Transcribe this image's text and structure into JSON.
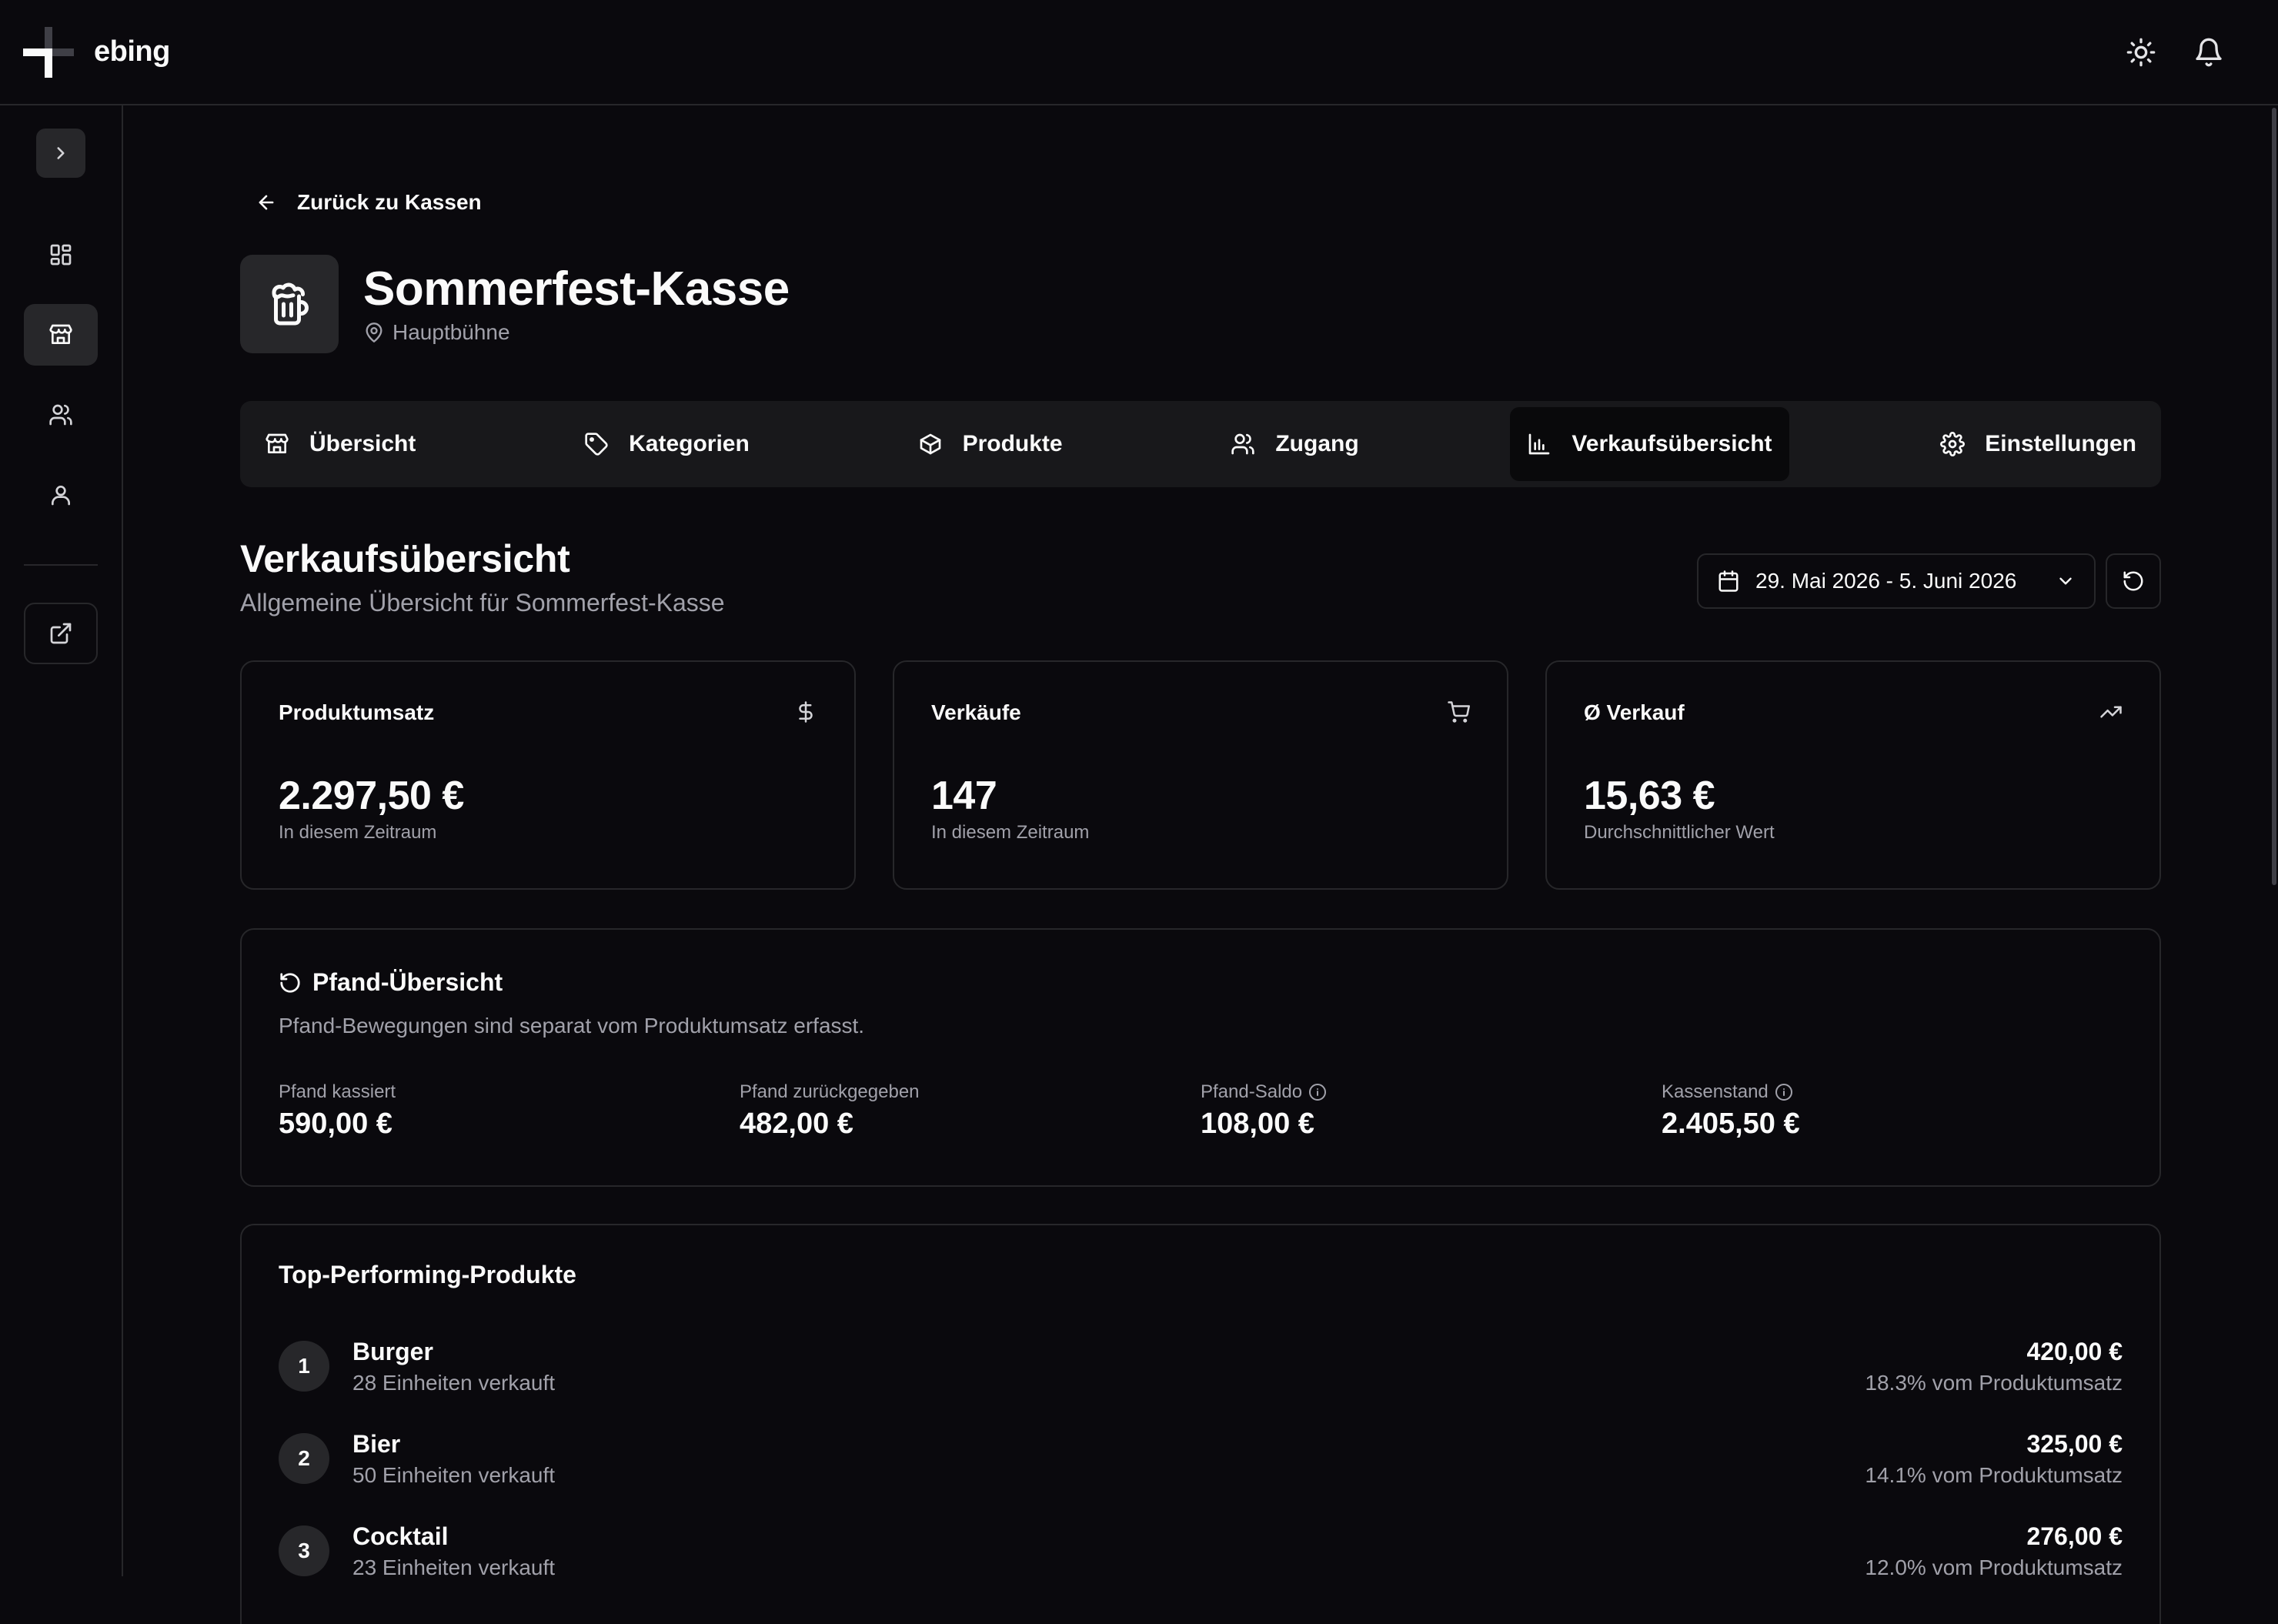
{
  "app": {
    "name": "ebing"
  },
  "nav": {
    "back_label": "Zurück zu Kassen"
  },
  "kasse": {
    "title": "Sommerfest-Kasse",
    "location": "Hauptbühne"
  },
  "tabs": [
    {
      "label": "Übersicht",
      "icon": "store-icon"
    },
    {
      "label": "Kategorien",
      "icon": "tag-icon"
    },
    {
      "label": "Produkte",
      "icon": "package-icon"
    },
    {
      "label": "Zugang",
      "icon": "users-icon"
    },
    {
      "label": "Verkaufsübersicht",
      "icon": "bar-chart-icon",
      "active": true
    },
    {
      "label": "Einstellungen",
      "icon": "gear-icon"
    }
  ],
  "section": {
    "title": "Verkaufsübersicht",
    "subtitle": "Allgemeine Übersicht für Sommerfest-Kasse",
    "date_range": "29. Mai 2026 - 5. Juni 2026"
  },
  "stats": [
    {
      "label": "Produktumsatz",
      "value": "2.297,50 €",
      "note": "In diesem Zeitraum",
      "icon": "dollar-icon"
    },
    {
      "label": "Verkäufe",
      "value": "147",
      "note": "In diesem Zeitraum",
      "icon": "cart-icon"
    },
    {
      "label": "Ø Verkauf",
      "value": "15,63 €",
      "note": "Durchschnittlicher Wert",
      "icon": "trending-up-icon"
    }
  ],
  "pfand": {
    "title": "Pfand-Übersicht",
    "description": "Pfand-Bewegungen sind separat vom Produktumsatz erfasst.",
    "items": [
      {
        "label": "Pfand kassiert",
        "value": "590,00 €",
        "info": false
      },
      {
        "label": "Pfand zurückgegeben",
        "value": "482,00 €",
        "info": false
      },
      {
        "label": "Pfand-Saldo",
        "value": "108,00 €",
        "info": true
      },
      {
        "label": "Kassenstand",
        "value": "2.405,50 €",
        "info": true
      }
    ]
  },
  "top_products": {
    "title": "Top-Performing-Produkte",
    "items": [
      {
        "rank": "1",
        "name": "Burger",
        "units": "28 Einheiten verkauft",
        "amount": "420,00 €",
        "share": "18.3% vom Produktumsatz"
      },
      {
        "rank": "2",
        "name": "Bier",
        "units": "50 Einheiten verkauft",
        "amount": "325,00 €",
        "share": "14.1% vom Produktumsatz"
      },
      {
        "rank": "3",
        "name": "Cocktail",
        "units": "23 Einheiten verkauft",
        "amount": "276,00 €",
        "share": "12.0% vom Produktumsatz"
      }
    ]
  },
  "colors": {
    "background": "#0a090d",
    "surface": "#18181b",
    "border": "#27272a",
    "muted_text": "#a1a1aa"
  }
}
